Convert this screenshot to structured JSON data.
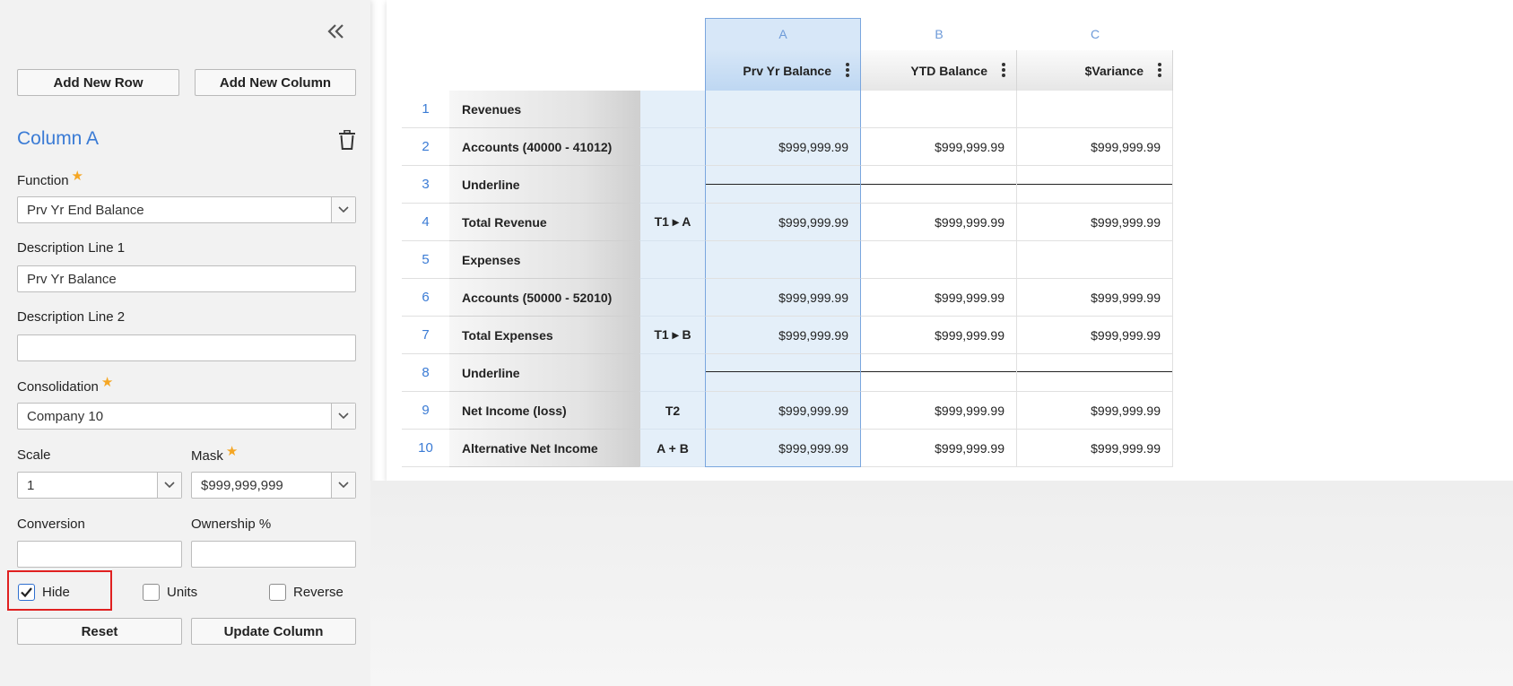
{
  "panel": {
    "add_row_label": "Add New Row",
    "add_column_label": "Add New Column",
    "column_title": "Column A",
    "function_label": "Function",
    "function_value": "Prv Yr End Balance",
    "desc1_label": "Description Line 1",
    "desc1_value": "Prv Yr Balance",
    "desc2_label": "Description Line 2",
    "desc2_value": "",
    "consolidation_label": "Consolidation",
    "consolidation_value": "Company 10",
    "scale_label": "Scale",
    "scale_value": "1",
    "mask_label": "Mask",
    "mask_value": "$999,999,999",
    "conversion_label": "Conversion",
    "conversion_value": "",
    "ownership_label": "Ownership %",
    "ownership_value": "",
    "hide_label": "Hide",
    "hide_checked": true,
    "units_label": "Units",
    "units_checked": false,
    "reverse_label": "Reverse",
    "reverse_checked": false,
    "reset_label": "Reset",
    "update_label": "Update Column",
    "required_star": "★"
  },
  "grid": {
    "columns": [
      {
        "letter": "A",
        "name": "Prv Yr Balance"
      },
      {
        "letter": "B",
        "name": "YTD Balance"
      },
      {
        "letter": "C",
        "name": "$Variance"
      }
    ],
    "rows": [
      {
        "num": "1",
        "desc": "Revenues",
        "calc": "",
        "a": "",
        "b": "",
        "c": ""
      },
      {
        "num": "2",
        "desc": "Accounts (40000 - 41012)",
        "calc": "",
        "a": "$999,999.99",
        "b": "$999,999.99",
        "c": "$999,999.99"
      },
      {
        "num": "3",
        "desc": "Underline",
        "calc": "",
        "a": "",
        "b": "",
        "c": ""
      },
      {
        "num": "4",
        "desc": "Total Revenue",
        "calc": "T1 ▸ A",
        "a": "$999,999.99",
        "b": "$999,999.99",
        "c": "$999,999.99"
      },
      {
        "num": "5",
        "desc": "Expenses",
        "calc": "",
        "a": "",
        "b": "",
        "c": ""
      },
      {
        "num": "6",
        "desc": "Accounts (50000 - 52010)",
        "calc": "",
        "a": "$999,999.99",
        "b": "$999,999.99",
        "c": "$999,999.99"
      },
      {
        "num": "7",
        "desc": "Total Expenses",
        "calc": "T1 ▸ B",
        "a": "$999,999.99",
        "b": "$999,999.99",
        "c": "$999,999.99"
      },
      {
        "num": "8",
        "desc": "Underline",
        "calc": "",
        "a": "",
        "b": "",
        "c": ""
      },
      {
        "num": "9",
        "desc": "Net Income (loss)",
        "calc": "T2",
        "a": "$999,999.99",
        "b": "$999,999.99",
        "c": "$999,999.99"
      },
      {
        "num": "10",
        "desc": "Alternative Net Income",
        "calc": "A + B",
        "a": "$999,999.99",
        "b": "$999,999.99",
        "c": "$999,999.99"
      }
    ]
  }
}
